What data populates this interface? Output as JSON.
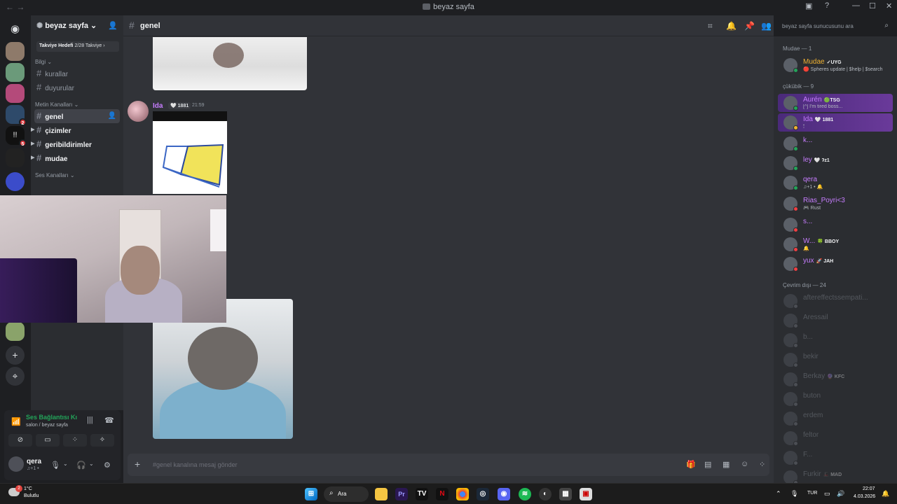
{
  "window": {
    "title": "beyaz sayfa"
  },
  "server": {
    "name": "beyaz sayfa",
    "boost": {
      "label": "Takviye Hedefi",
      "progress": "2/28 Takviye"
    },
    "categories": [
      {
        "label": "Bilgi",
        "channels": [
          {
            "name": "kurallar"
          },
          {
            "name": "duyurular"
          }
        ]
      },
      {
        "label": "Metin Kanalları",
        "channels": [
          {
            "name": "genel"
          },
          {
            "name": "çizimler"
          },
          {
            "name": "geribildirimler"
          },
          {
            "name": "mudae"
          }
        ]
      },
      {
        "label": "Ses Kanalları"
      }
    ]
  },
  "voice": {
    "status": "Ses Bağlantısı Kı",
    "location": "salon / beyaz sayfa"
  },
  "user": {
    "name": "qera",
    "status": "♫+1 •"
  },
  "channel": {
    "name": "genel",
    "composer_placeholder": "#genel kanalına mesaj gönder"
  },
  "message": {
    "author": "Ida",
    "tag": "🤍 1881",
    "time": "21:59"
  },
  "members": {
    "search_placeholder": "beyaz sayfa sunucusunu ara",
    "groups": [
      {
        "label": "Mudae — 1"
      },
      {
        "label": "çükübik — 9"
      },
      {
        "label": "Çevrim dışı — 24"
      }
    ],
    "list": [
      {
        "name": "Mudae",
        "tag": "✓UYG",
        "sub": "🔴 Spheres update | $help | $search",
        "color": "#f0b232",
        "status": "#23a55a"
      },
      {
        "name": "Aurén",
        "tag": "🟢TSG",
        "sub": "[^] I'm tired boss...",
        "color": "#c77dff",
        "status": "#23a55a"
      },
      {
        "name": "Ida",
        "tag": "🤍 1881",
        "sub": "🕯",
        "color": "#c77dff",
        "status": "#f0b232"
      },
      {
        "name": "k...",
        "tag": "",
        "sub": "",
        "color": "#c77dff",
        "status": "#23a55a"
      },
      {
        "name": "ley",
        "tag": "🤍 ʔz1",
        "sub": "",
        "color": "#c77dff",
        "status": "#23a55a"
      },
      {
        "name": "qera",
        "tag": "",
        "sub": "♫+1 • 🔔",
        "color": "#c77dff",
        "status": "#23a55a"
      },
      {
        "name": "Rias_Poyri<3",
        "tag": "",
        "sub": "🎮 Rust",
        "color": "#c77dff",
        "status": "#f23f43"
      },
      {
        "name": "s...",
        "tag": "",
        "sub": "",
        "color": "#c77dff",
        "status": "#f23f43"
      },
      {
        "name": "W...",
        "tag": "🍀 BBOY",
        "sub": "🔔",
        "color": "#c77dff",
        "status": "#f23f43"
      },
      {
        "name": "yux",
        "tag": "🚀 JAH",
        "sub": "",
        "color": "#c77dff",
        "status": "#f23f43"
      },
      {
        "name": "aftereffectssempati...",
        "tag": "",
        "sub": "",
        "color": "#949ba4",
        "status": "#80848e"
      },
      {
        "name": "Aressail",
        "tag": "",
        "sub": "",
        "color": "#949ba4",
        "status": "#80848e"
      },
      {
        "name": "b...",
        "tag": "",
        "sub": "",
        "color": "#949ba4",
        "status": "#80848e"
      },
      {
        "name": "bekir",
        "tag": "",
        "sub": "",
        "color": "#949ba4",
        "status": "#80848e"
      },
      {
        "name": "Berkay",
        "tag": "🔮 KFC",
        "sub": "",
        "color": "#949ba4",
        "status": "#80848e"
      },
      {
        "name": "buton",
        "tag": "",
        "sub": "",
        "color": "#949ba4",
        "status": "#80848e"
      },
      {
        "name": "erdem",
        "tag": "",
        "sub": "",
        "color": "#949ba4",
        "status": "#80848e"
      },
      {
        "name": "feltor",
        "tag": "",
        "sub": "",
        "color": "#949ba4",
        "status": "#80848e"
      },
      {
        "name": "F...",
        "tag": "",
        "sub": "",
        "color": "#949ba4",
        "status": "#80848e"
      },
      {
        "name": "Furkir",
        "tag": "🎩 MAD",
        "sub": "",
        "color": "#949ba4",
        "status": "#80848e"
      }
    ]
  },
  "taskbar": {
    "weather": {
      "temp": "1°C",
      "cond": "Bulutlu",
      "badge": "2"
    },
    "search_label": "Ara",
    "lang": "TUR",
    "time": "22:07",
    "date": "4.03.2026"
  },
  "rail_badges": [
    "2",
    "5"
  ],
  "colors": {
    "accent": "#5865f2",
    "online": "#23a55a",
    "idle": "#f0b232",
    "dnd": "#f23f43"
  }
}
